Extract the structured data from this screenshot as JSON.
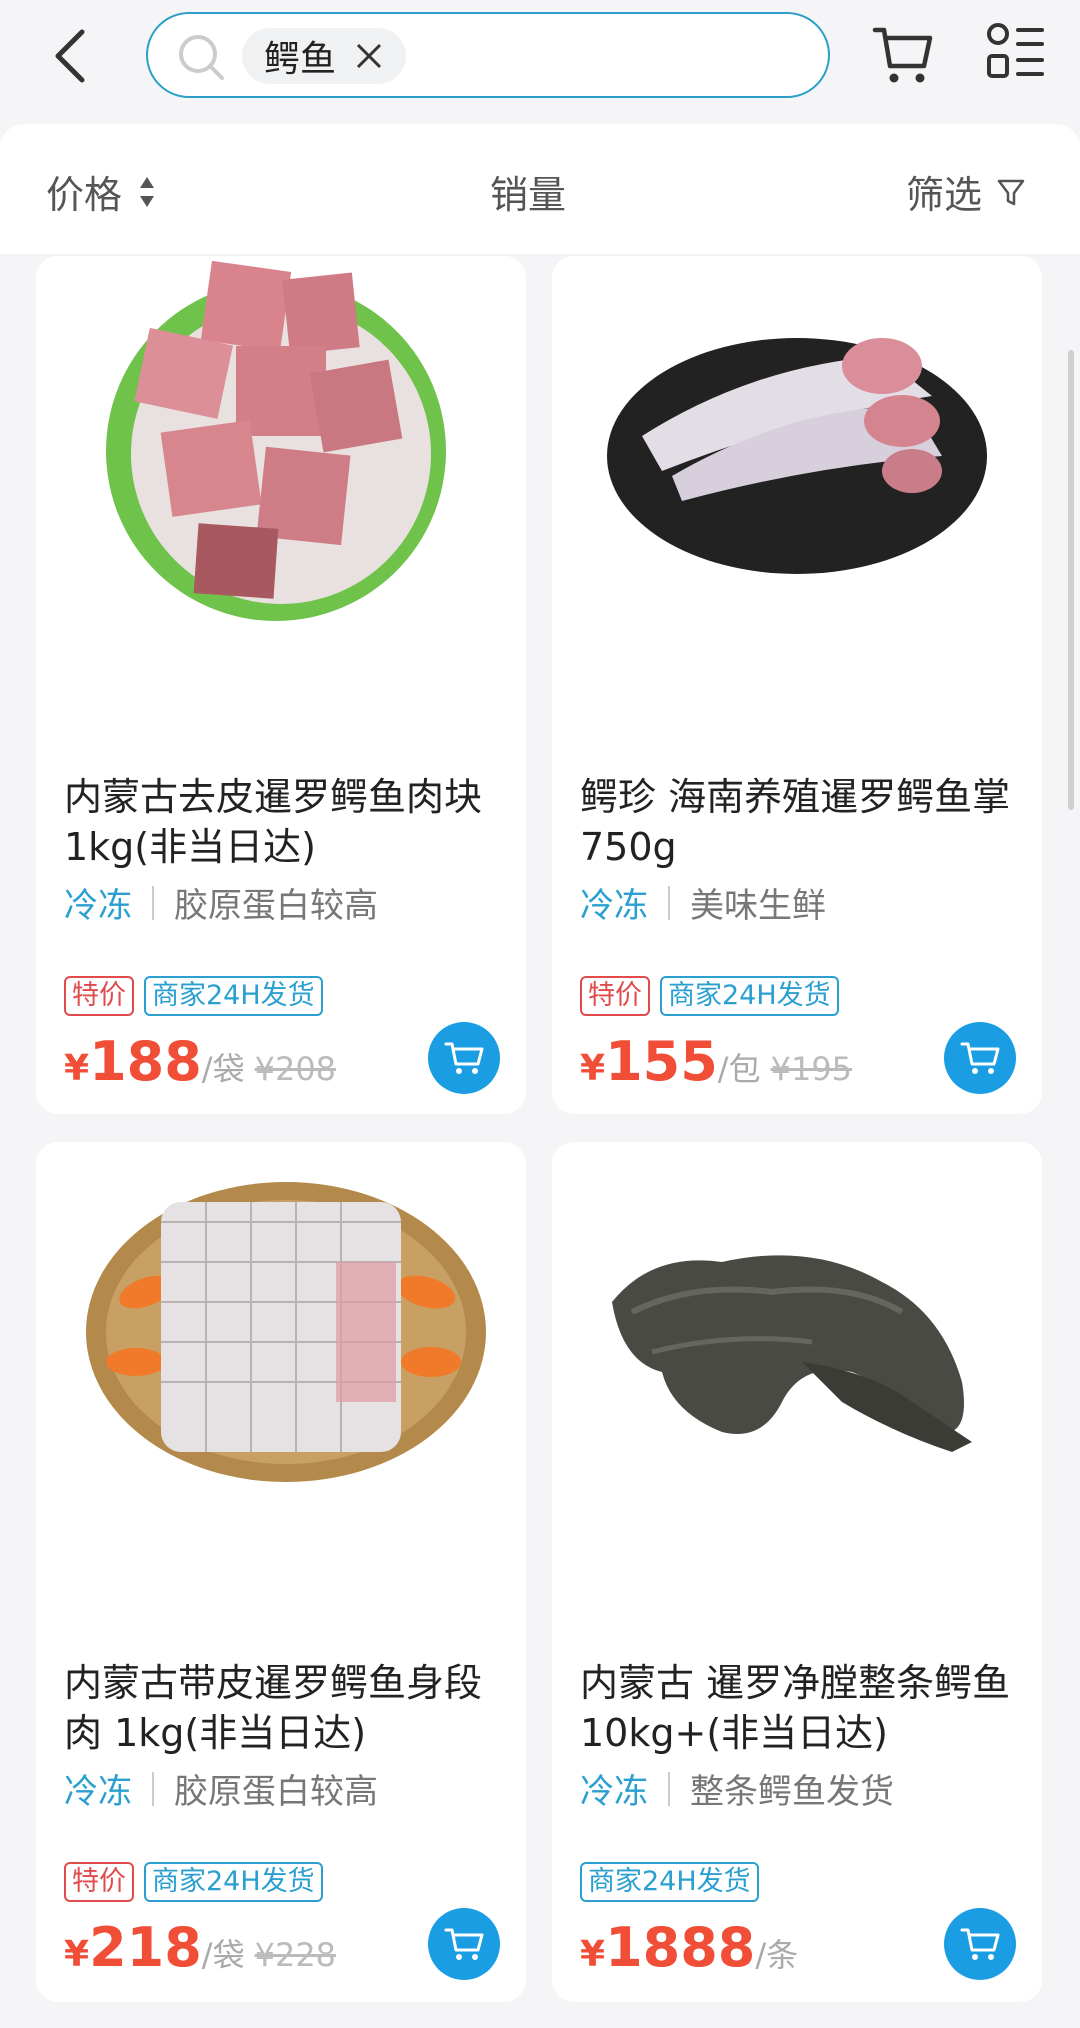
{
  "search": {
    "query": "鳄鱼"
  },
  "sort": {
    "price": "价格",
    "sales": "销量",
    "filter": "筛选"
  },
  "products": [
    {
      "title": "内蒙古去皮暹罗鳄鱼肉块 1kg(非当日达)",
      "storage": "冷冻",
      "desc": "胶原蛋白较高",
      "badge_special": "特价",
      "badge_ship": "商家24H发货",
      "yen": "¥",
      "price": "188",
      "unit": "/袋",
      "orig": "¥208"
    },
    {
      "title": "鳄珍 海南养殖暹罗鳄鱼掌 750g",
      "storage": "冷冻",
      "desc": "美味生鲜",
      "badge_special": "特价",
      "badge_ship": "商家24H发货",
      "yen": "¥",
      "price": "155",
      "unit": "/包",
      "orig": "¥195"
    },
    {
      "title": "内蒙古带皮暹罗鳄鱼身段肉 1kg(非当日达)",
      "storage": "冷冻",
      "desc": "胶原蛋白较高",
      "badge_special": "特价",
      "badge_ship": "商家24H发货",
      "yen": "¥",
      "price": "218",
      "unit": "/袋",
      "orig": "¥228"
    },
    {
      "title": "内蒙古 暹罗净膛整条鳄鱼 10kg+(非当日达)",
      "storage": "冷冻",
      "desc": "整条鳄鱼发货",
      "badge_ship": "商家24H发货",
      "yen": "¥",
      "price": "1888",
      "unit": "/条"
    }
  ],
  "colors": {
    "accent": "#1a9de3",
    "price": "#f04e37",
    "special": "#e04c4c"
  }
}
